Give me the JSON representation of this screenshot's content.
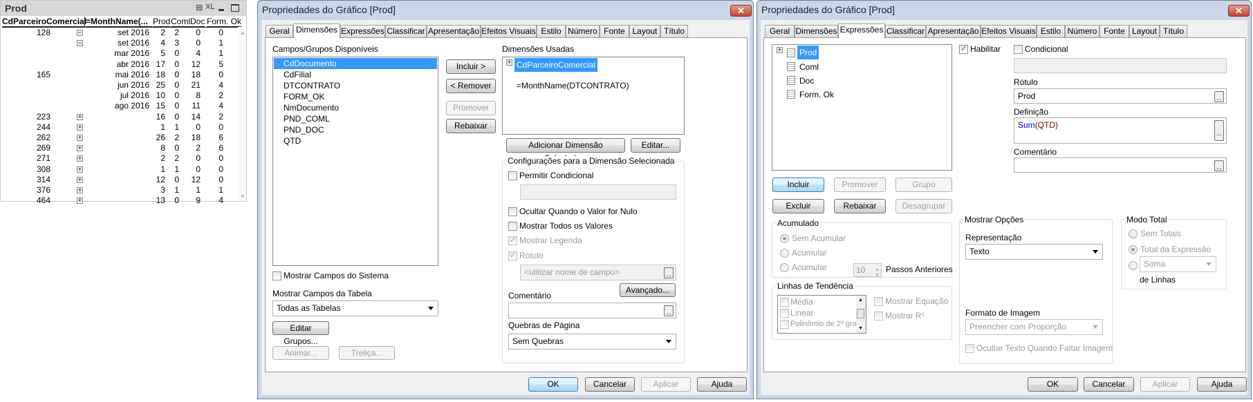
{
  "table": {
    "title": "Prod",
    "icons": [
      "print-icon",
      "excel-icon",
      "minimize-icon",
      "maximize-icon"
    ],
    "xl_label": "XL",
    "headers": [
      "CdParceiroComercial",
      "=MonthName(...",
      "Prod",
      "Coml",
      "Doc",
      "Form. Ok"
    ],
    "rows": [
      [
        "128",
        "minus",
        "set 2016",
        "2",
        "2",
        "0",
        "0"
      ],
      [
        "",
        "minus",
        "set 2016",
        "4",
        "3",
        "0",
        "1"
      ],
      [
        "",
        "",
        "mar 2016",
        "5",
        "0",
        "4",
        "1"
      ],
      [
        "",
        "",
        "abr 2016",
        "17",
        "0",
        "12",
        "5"
      ],
      [
        "165",
        "",
        "mai 2016",
        "18",
        "0",
        "18",
        "0"
      ],
      [
        "",
        "",
        "jun 2016",
        "25",
        "0",
        "21",
        "4"
      ],
      [
        "",
        "",
        "jul 2016",
        "10",
        "0",
        "8",
        "2"
      ],
      [
        "",
        "",
        "ago 2016",
        "15",
        "0",
        "11",
        "4"
      ],
      [
        "223",
        "plus",
        "",
        "16",
        "0",
        "14",
        "2"
      ],
      [
        "244",
        "plus",
        "",
        "1",
        "1",
        "0",
        "0"
      ],
      [
        "262",
        "plus",
        "",
        "26",
        "2",
        "18",
        "6"
      ],
      [
        "269",
        "plus",
        "",
        "8",
        "0",
        "2",
        "6"
      ],
      [
        "271",
        "plus",
        "",
        "2",
        "2",
        "0",
        "0"
      ],
      [
        "308",
        "plus",
        "",
        "1",
        "1",
        "0",
        "0"
      ],
      [
        "314",
        "plus",
        "",
        "12",
        "0",
        "12",
        "0"
      ],
      [
        "376",
        "plus",
        "",
        "3",
        "1",
        "1",
        "1"
      ],
      [
        "464",
        "plus",
        "",
        "13",
        "0",
        "9",
        "4"
      ]
    ]
  },
  "tabs": [
    "Geral",
    "Dimensões",
    "Expressões",
    "Classificar",
    "Apresentação",
    "Efeitos Visuais",
    "Estilo",
    "Número",
    "Fonte",
    "Layout",
    "Título"
  ],
  "footer": {
    "ok": "OK",
    "cancel": "Cancelar",
    "apply": "Aplicar",
    "help": "Ajuda"
  },
  "dialog1": {
    "title": "Propriedades do Gráfico [Prod]",
    "active_tab": "Dimensões",
    "available_label": "Campos/Grupos Disponíveis",
    "available_fields": [
      "CdDocumento",
      "CdFilial",
      "DTCONTRATO",
      "FORM_OK",
      "NmDocumento",
      "PND_COML",
      "PND_DOC",
      "QTD"
    ],
    "include": "Incluir >",
    "remove": "< Remover",
    "promote": "Promover",
    "demote": "Rebaixar",
    "used_label": "Dimensões Usadas",
    "used_dimensions": [
      "CdParceiroComercial",
      "=MonthName(DTCONTRATO)"
    ],
    "add_calc": "Adicionar Dimensão Calculada...",
    "edit": "Editar...",
    "settings_legend": "Configurações para a Dimensão Selecionada",
    "allow_conditional": "Permitir Condicional",
    "hide_null": "Ocultar Quando o Valor for Nulo",
    "show_all": "Mostrar Todos os Valores",
    "show_legend": "Mostrar Legenda",
    "label": "Rótulo",
    "label_placeholder": "<utilizar nome de campo>",
    "advanced": "Avançado...",
    "comment": "Comentário",
    "page_breaks": "Quebras de Página",
    "page_breaks_value": "Sem Quebras",
    "show_system_fields": "Mostrar Campos do Sistema",
    "show_table_fields": "Mostrar Campos da Tabela",
    "table_fields_value": "Todas as Tabelas",
    "edit_groups": "Editar Grupos...",
    "animate": "Animar...",
    "trellis": "Treliça..."
  },
  "dialog2": {
    "title": "Propriedades do Gráfico [Prod]",
    "active_tab": "Expressões",
    "expressions": [
      "Prod",
      "Coml",
      "Doc",
      "Form. Ok"
    ],
    "enable": "Habilitar",
    "conditional": "Condicional",
    "label": "Rótulo",
    "label_value": "Prod",
    "definition": "Definição",
    "definition_func": "Sum",
    "definition_arg": "(QTD)",
    "definition_func_color": "#0000ff",
    "definition_arg_color": "#800000",
    "comment": "Comentário",
    "include": "Incluir",
    "promote": "Promover",
    "group": "Grupo",
    "delete": "Excluir",
    "demote": "Rebaixar",
    "ungroup": "Desagrupar",
    "accumulate_legend": "Acumulado",
    "no_accumulate": "Sem Acumular",
    "accumulate": "Acumular",
    "accumulate_n": "Acumular",
    "steps_value": "10",
    "steps_label": "Passos Anteriores",
    "trend_legend": "Linhas de Tendência",
    "trend_items": [
      "Média",
      "Linear",
      "Polinômio de 2º gra"
    ],
    "show_equation": "Mostrar Equação",
    "show_r2": "Mostrar R²",
    "display_legend": "Mostrar Opções",
    "representation": "Representação",
    "representation_value": "Texto",
    "image_format": "Formato de Imagem",
    "image_format_value": "Preencher com Proporção",
    "hide_text": "Ocultar Texto Quando Faltar Imagem",
    "total_legend": "Modo Total",
    "no_totals": "Sem Totais",
    "expression_total": "Total da Expressão",
    "sum_value": "Soma",
    "of_rows": "de Linhas"
  }
}
